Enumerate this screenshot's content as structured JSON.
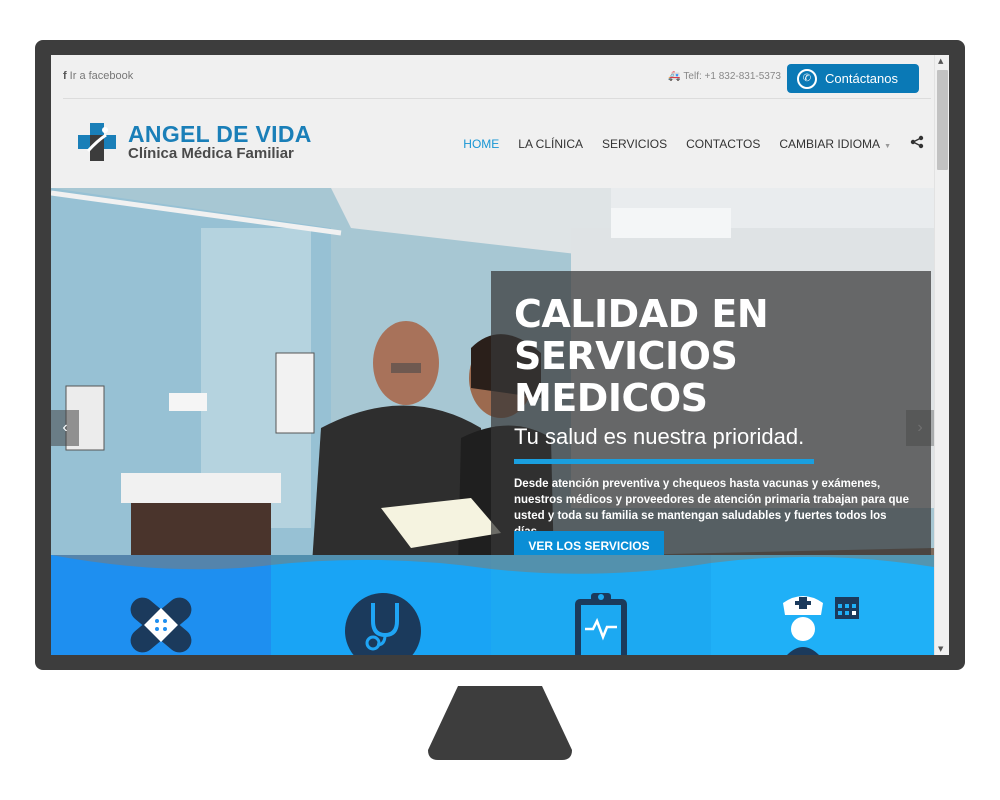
{
  "topbar": {
    "facebook_label": "Ir a facebook",
    "phone": "Telf: +1 832-831-5373",
    "contact_button": "Contáctanos"
  },
  "logo": {
    "line1": "ANGEL DE VIDA",
    "line2": "Clínica Médica Familiar"
  },
  "nav": {
    "items": [
      "HOME",
      "LA CLÍNICA",
      "SERVICIOS",
      "CONTACTOS",
      "CAMBIAR IDIOMA"
    ],
    "active": "HOME"
  },
  "hero": {
    "title": "CALIDAD EN SERVICIOS MEDICOS",
    "subtitle": "Tu salud es nuestra prioridad.",
    "description": "Desde atención preventiva y chequeos hasta vacunas y exámenes, nuestros médicos y proveedores de atención primaria trabajan para que usted y toda su familia se mantengan saludables y fuertes todos los días.",
    "button": "VER LOS SERVICIOS"
  },
  "features": [
    {
      "icon": "bandage-icon",
      "color": "#1e8ff0"
    },
    {
      "icon": "stethoscope-icon",
      "color": "#19a4f5"
    },
    {
      "icon": "clipboard-icon",
      "color": "#1ca9f2"
    },
    {
      "icon": "nurse-calendar-icon",
      "color": "#1fb0f7"
    }
  ],
  "colors": {
    "brand_blue": "#1a7fb8",
    "accent_blue": "#1996d4",
    "contact_button": "#0a79b6"
  }
}
